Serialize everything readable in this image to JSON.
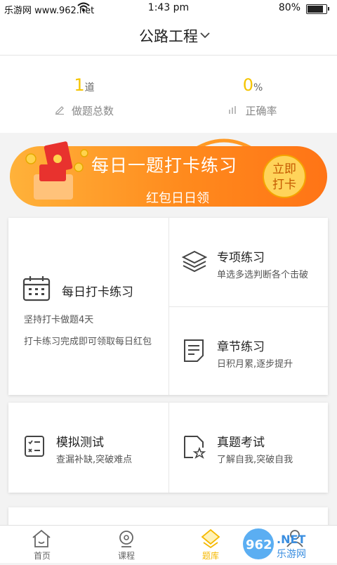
{
  "statusbar": {
    "carrier": "乐游网 www.962.net",
    "time": "1:43 pm",
    "battery": "80%",
    "battery_level": 0.8
  },
  "header": {
    "title": "公路工程"
  },
  "stats": {
    "answered": {
      "value": "1",
      "unit": "道",
      "label": "做题总数"
    },
    "accuracy": {
      "value": "0",
      "unit": "%",
      "label": "正确率"
    }
  },
  "banner": {
    "title": "每日一题打卡练习",
    "subtitle": "红包日日领",
    "button_line1": "立即",
    "button_line2": "打卡"
  },
  "daily": {
    "title": "每日打卡练习",
    "line1": "坚持打卡做题4天",
    "line2": "打卡练习完成即可领取每日红包"
  },
  "special": {
    "title": "专项练习",
    "sub": "单选多选判断各个击破"
  },
  "chapter": {
    "title": "章节练习",
    "sub": "日积月累,逐步提升"
  },
  "mock": {
    "title": "模拟测试",
    "sub": "查漏补缺,突破难点"
  },
  "real": {
    "title": "真题考试",
    "sub": "了解自我,突破自我"
  },
  "tabs": [
    {
      "label": "首页",
      "icon": "home-icon"
    },
    {
      "label": "课程",
      "icon": "course-icon"
    },
    {
      "label": "题库",
      "icon": "question-bank-icon"
    },
    {
      "label": "",
      "icon": "profile-icon"
    }
  ],
  "watermark": {
    "text": "962.NET",
    "sub": "乐游网"
  },
  "colors": {
    "accent": "#f5c400",
    "banner": "#ff8a1d",
    "tab_active": "#f5b800"
  }
}
